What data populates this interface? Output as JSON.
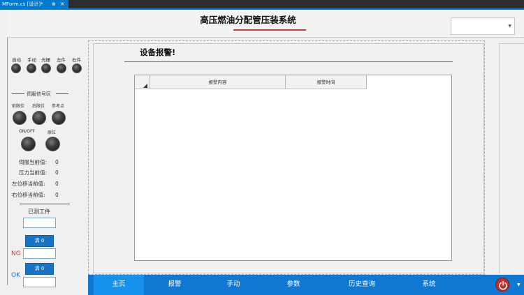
{
  "ide": {
    "doc_tab": "MForm.cs [设计]*",
    "pin_icon": "pin-icon",
    "close_icon": "close-icon"
  },
  "header": {
    "title": "高压燃油分配管压装系统",
    "accent_color": "#c83c3c",
    "dropdown_value": ""
  },
  "mode_lamps": [
    {
      "label": "自动"
    },
    {
      "label": "手动"
    },
    {
      "label": "光栅"
    },
    {
      "label": "左件"
    },
    {
      "label": "右件"
    }
  ],
  "servo": {
    "section_title": "伺服信号区",
    "lamps_row1": [
      {
        "label": "前限位"
      },
      {
        "label": "后限位"
      },
      {
        "label": "参考点"
      }
    ],
    "lamps_row2": [
      {
        "label": "ON/OFF"
      },
      {
        "label": "原位"
      }
    ],
    "readings": [
      {
        "label": "伺服当前值:",
        "value": "0"
      },
      {
        "label": "压力当前值:",
        "value": "0"
      },
      {
        "label": "左位移当前值:",
        "value": "0"
      },
      {
        "label": "右位移当前值:",
        "value": "0"
      }
    ]
  },
  "production": {
    "section_title": "已测工件",
    "clear1_label": "清 0",
    "ng_label": "NG",
    "clear2_label": "清 0",
    "ok_label": "OK"
  },
  "alarm": {
    "title": "设备报警!",
    "columns": [
      "报警内容",
      "报警时间"
    ],
    "rows": []
  },
  "nav": {
    "items": [
      {
        "label": "主页",
        "active": true
      },
      {
        "label": "报警",
        "active": false
      },
      {
        "label": "手动",
        "active": false
      },
      {
        "label": "参数",
        "active": false
      },
      {
        "label": "历史查询",
        "active": false
      },
      {
        "label": "系统",
        "active": false
      }
    ],
    "power_icon": "power-icon",
    "active_color": "#1592ee",
    "bar_color": "#0f78d2"
  }
}
